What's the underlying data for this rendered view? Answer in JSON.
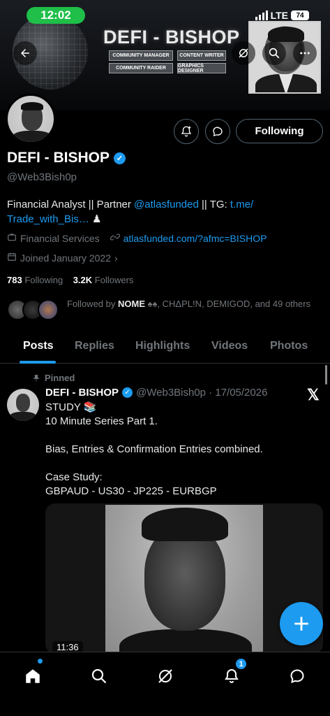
{
  "status_bar": {
    "time": "12:02",
    "network": "LTE",
    "battery": "74"
  },
  "banner": {
    "title": "DEFI - BISHOP",
    "tags": [
      "COMMUNITY MANAGER",
      "CONTENT WRITER",
      "COMMUNITY RAIDER",
      "GRAPHICS DESIGNER"
    ]
  },
  "profile": {
    "name": "DEFI - BISHOP",
    "handle": "@Web3Bish0p",
    "follow_button": "Following",
    "bio_prefix": "Financial Analyst || Partner ",
    "bio_mention": "@atlasfunded",
    "bio_mid": " || TG: ",
    "bio_link": "t.me/\nTrade_with_Bis…",
    "bio_suffix": " ♟",
    "category": "Financial Services",
    "website": "atlasfunded.com/?afmc=BISHOP",
    "joined": "Joined January 2022",
    "following_count": "783",
    "following_label": "Following",
    "followers_count": "3.2K",
    "followers_label": "Followers",
    "followed_by_prefix": "Followed by ",
    "followed_by_first": "NOME",
    "followed_by_rest": ", CHΔPL!N, DEMIGOD, and 49 others"
  },
  "tabs": [
    "Posts",
    "Replies",
    "Highlights",
    "Videos",
    "Photos"
  ],
  "post": {
    "pinned_label": "Pinned",
    "author": "DEFI - BISHOP",
    "handle_date": "@Web3Bish0p · 17/05/2026",
    "text": "STUDY 📚\n10 Minute Series Part 1.\n\nBias, Entries & Confirmation Entries combined.\n\nCase Study:\nGBPAUD - US30 - JP225 - EURBGP",
    "video_duration": "11:36"
  },
  "nav": {
    "notifications_badge": "1"
  },
  "colors": {
    "accent": "#1d9bf0",
    "status_green": "#1fbf4a",
    "muted": "#71767b"
  }
}
